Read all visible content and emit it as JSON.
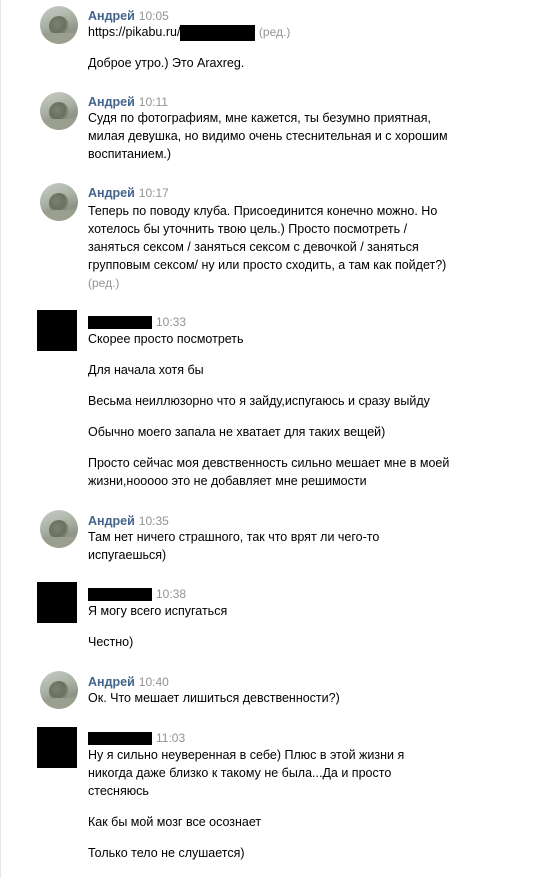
{
  "messages": {
    "m1": {
      "author": "Андрей",
      "time": "10:05",
      "link": "https://pikabu.ru/",
      "edited": "(ред.)",
      "text": "Доброе утро.) Это Araxreg."
    },
    "m2": {
      "author": "Андрей",
      "time": "10:11",
      "lines": [
        "Судя по фотографиям, мне кажется, ты безумно приятная,",
        "милая девушка, но видимо очень стеснительная и с хорошим",
        "воспитанием.)"
      ]
    },
    "m3": {
      "author": "Андрей",
      "time": "10:17",
      "lines": [
        "Теперь по поводу клуба. Присоединится конечно можно. Но",
        "хотелось бы уточнить твою цель.) Просто посмотреть /",
        "заняться сексом / заняться сексом с девочкой / заняться",
        "групповым сексом/ ну или просто сходить, а там как пойдет?)"
      ],
      "edited": "(ред.)"
    },
    "m4": {
      "time": "10:33",
      "texts": [
        "Скорее просто посмотреть",
        "Для начала хотя бы",
        "Весьма неиллюзорно что я зайду,испугаюсь и сразу выйду",
        "Обычно моего запала не хватает для таких вещей)",
        "Просто сейчас моя девственность сильно мешает мне в моей",
        "жизни,нооооо это не добавляет мне решимости"
      ]
    },
    "m5": {
      "author": "Андрей",
      "time": "10:35",
      "lines": [
        "Там нет ничего страшного, так что врят ли чего-то",
        "испугаешься)"
      ]
    },
    "m6": {
      "time": "10:38",
      "texts": [
        "Я могу всего испугаться",
        "Честно)"
      ]
    },
    "m7": {
      "author": "Андрей",
      "time": "10:40",
      "text": "Ок. Что мешает лишиться девственности?)"
    },
    "m8": {
      "time": "11:03",
      "texts": [
        "Ну я сильно неуверенная в себе) Плюс в этой жизни я",
        "никогда даже близко к такому не была...Да и просто",
        "стесняюсь",
        "Как бы мой мозг все осознает",
        "Только тело не слушается)"
      ]
    }
  }
}
